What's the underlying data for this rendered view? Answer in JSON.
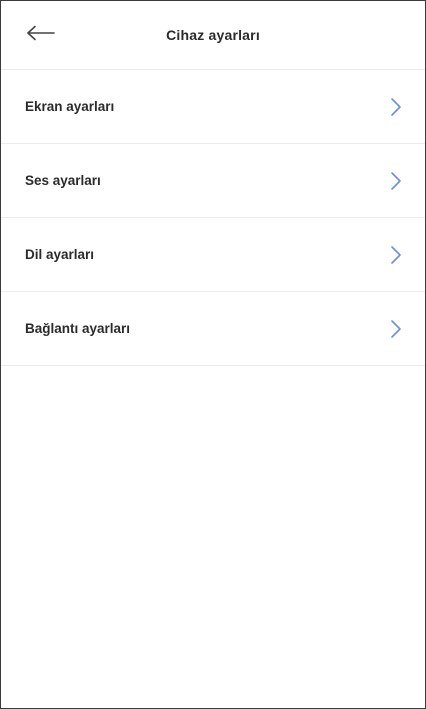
{
  "header": {
    "title": "Cihaz ayarları",
    "back_icon": "arrow-left-icon"
  },
  "settings": {
    "items": [
      {
        "label": "Ekran ayarları",
        "icon": "chevron-right-icon"
      },
      {
        "label": "Ses ayarları",
        "icon": "chevron-right-icon"
      },
      {
        "label": "Dil ayarları",
        "icon": "chevron-right-icon"
      },
      {
        "label": "Bağlantı ayarları",
        "icon": "chevron-right-icon"
      }
    ]
  },
  "colors": {
    "accent": "#6b8fd8",
    "text": "#2b2b2b",
    "divider": "#ececec"
  }
}
